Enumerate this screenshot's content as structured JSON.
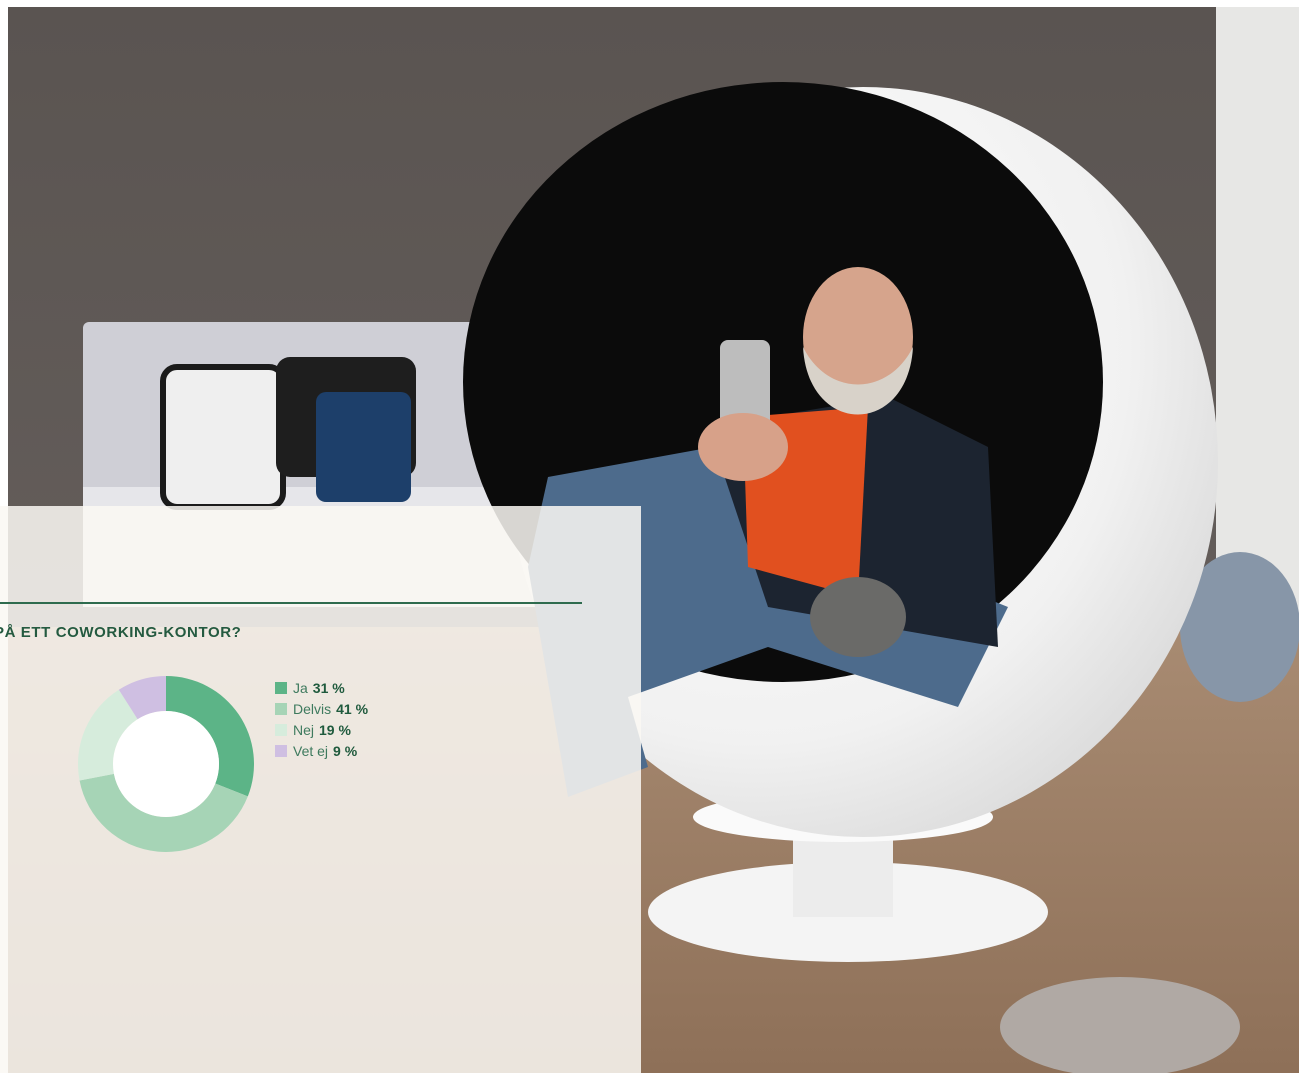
{
  "chart_data": {
    "type": "pie",
    "variant": "donut",
    "title": "PÅ ETT COWORKING-KONTOR?",
    "slices": [
      {
        "label": "Ja",
        "value": 31,
        "display": "31 %",
        "color": "#5cb487"
      },
      {
        "label": "Delvis",
        "value": 41,
        "display": "41 %",
        "color": "#a6d4b6"
      },
      {
        "label": "Nej",
        "value": 19,
        "display": "19 %",
        "color": "#d6ecdc"
      },
      {
        "label": "Vet ej",
        "value": 9,
        "display": "9 %",
        "color": "#cfbfe2"
      }
    ],
    "legend_position": "right"
  },
  "colors": {
    "title": "#245a40",
    "rule": "#2e6b4e",
    "legend_text": "#3e7a5e"
  }
}
